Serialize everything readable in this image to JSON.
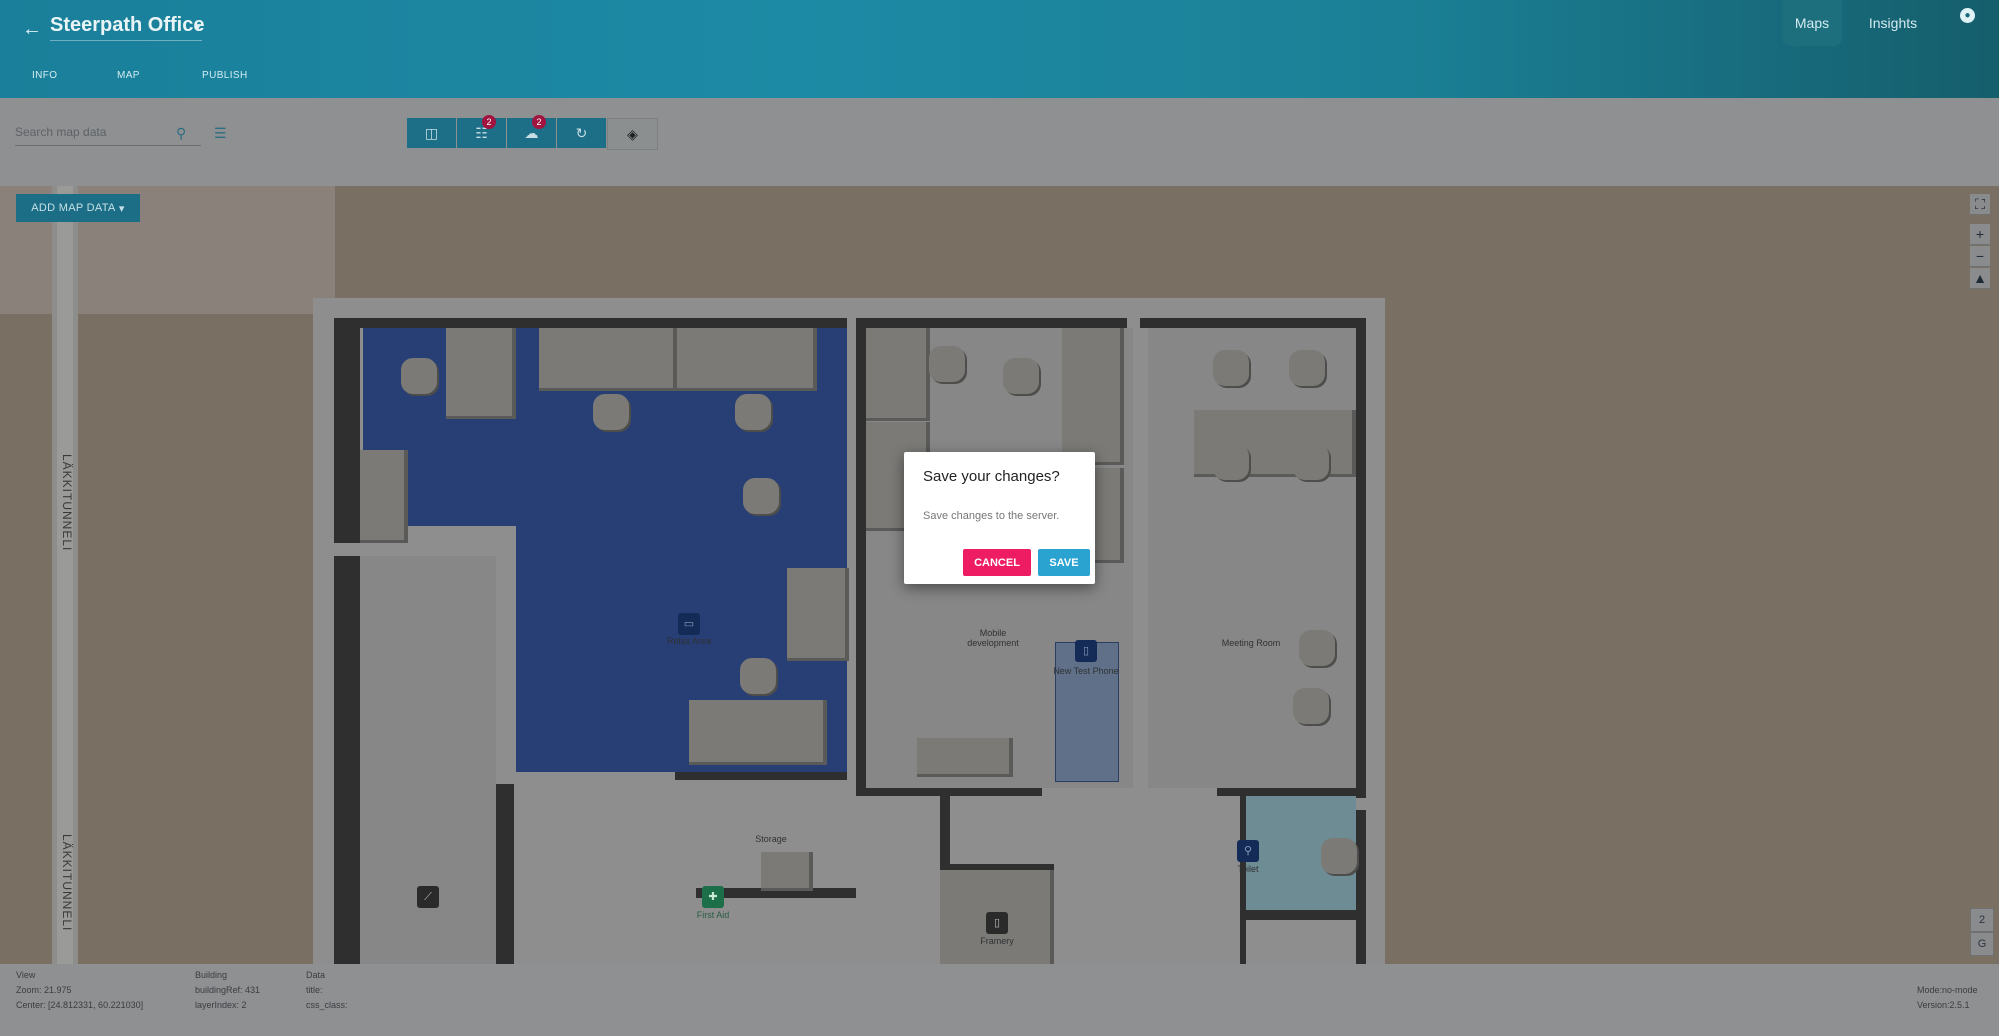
{
  "header": {
    "title": "Steerpath Office",
    "tabs": [
      {
        "label": "INFO"
      },
      {
        "label": "MAP"
      },
      {
        "label": "PUBLISH"
      }
    ],
    "nav": [
      {
        "label": "Maps"
      },
      {
        "label": "Insights"
      }
    ]
  },
  "toolbar": {
    "search_placeholder": "Search map data",
    "list_badge": "2",
    "upload_badge": "2"
  },
  "map": {
    "add_button": "ADD MAP DATA",
    "road_label": "LÄKKITUNNELI",
    "rooms": {
      "relax": "Relax Area",
      "mobile": "Mobile development",
      "newtest": "New Test Phone",
      "meeting": "Meeting Room",
      "storage": "Storage",
      "firstaid": "First Aid",
      "framery": "Framery",
      "toilet": "Toilet"
    },
    "floor_buttons": [
      "2",
      "G"
    ]
  },
  "status": {
    "view": "View",
    "zoom": "Zoom: 21.975",
    "center": "Center: [24.812331, 60.221030]",
    "building": "Building",
    "building_ref": "buildingRef: 431",
    "layer_index": "layerIndex: 2",
    "data": "Data",
    "data_title": "title:",
    "data_css": "css_class:",
    "mode": "Mode:no-mode",
    "version": "Version:2.5.1"
  },
  "dialog": {
    "title": "Save your changes?",
    "message": "Save changes to the server.",
    "cancel": "CANCEL",
    "save": "SAVE"
  }
}
